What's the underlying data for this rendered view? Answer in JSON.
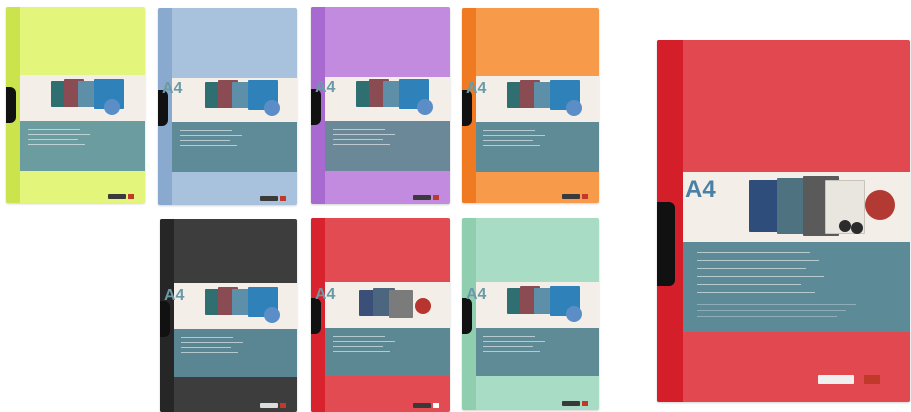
{
  "image": {
    "description_items": [
      {
        "id": "lime",
        "front": "#e3f57a",
        "spine": "#cbe34c",
        "panel": "#6a9ca0"
      },
      {
        "id": "blue",
        "front": "#a8c1dd",
        "spine": "#8aa9cf",
        "panel": "#5f8b98"
      },
      {
        "id": "purple",
        "front": "#c38bdf",
        "spine": "#a86ad1",
        "panel": "#6b8899"
      },
      {
        "id": "orange",
        "front": "#f79a4a",
        "spine": "#f07a22",
        "panel": "#5f8b96"
      },
      {
        "id": "black",
        "front": "#3d3d3d",
        "spine": "#262626",
        "panel": "#5a8693"
      },
      {
        "id": "red",
        "front": "#e34b52",
        "spine": "#d8232f",
        "panel": "#5c8894"
      },
      {
        "id": "mint",
        "front": "#a9dcc4",
        "spine": "#8fcfb0",
        "panel": "#5f8b96"
      }
    ],
    "featured": {
      "front": "#e2484f",
      "spine": "#d41f2b",
      "panel": "#5d8a97"
    },
    "label": "A4"
  }
}
